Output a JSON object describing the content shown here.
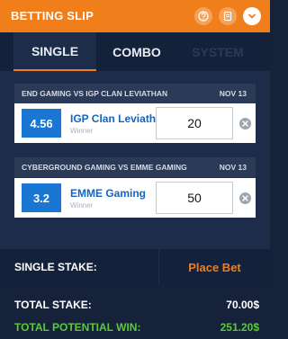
{
  "header": {
    "title": "BETTING SLIP",
    "accent": "#f07e1b",
    "icons": [
      "help-icon",
      "receipt-icon",
      "chevron-down-icon"
    ]
  },
  "tabs": [
    {
      "label": "SINGLE",
      "state": "active"
    },
    {
      "label": "COMBO",
      "state": "normal"
    },
    {
      "label": "SYSTEM",
      "state": "disabled"
    }
  ],
  "bets": [
    {
      "match": "END GAMING VS IGP CLAN LEVIATHAN",
      "date": "NOV 13",
      "odds": "4.56",
      "selection": "IGP Clan Leviathan",
      "market": "Winner",
      "stake": "20"
    },
    {
      "match": "CYBERGROUND GAMING VS EMME GAMING",
      "date": "NOV 13",
      "odds": "3.2",
      "selection": "EMME Gaming",
      "market": "Winner",
      "stake": "50"
    }
  ],
  "stake_bar": {
    "label": "SINGLE STAKE:",
    "place_bet": "Place Bet"
  },
  "totals": {
    "total_stake_label": "TOTAL STAKE:",
    "total_stake_value": "70.00$",
    "potential_win_label": "TOTAL POTENTIAL WIN:",
    "potential_win_value": "251.20$",
    "win_color": "#5cc93a"
  }
}
